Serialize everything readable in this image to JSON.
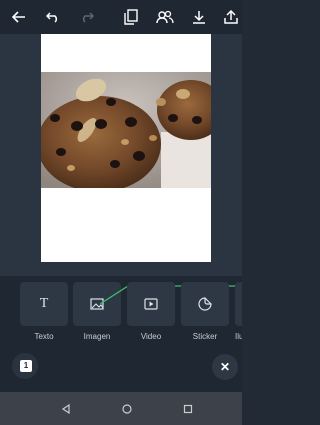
{
  "toolbar": {
    "icons": [
      "back-arrow-icon",
      "undo-icon",
      "redo-icon",
      "pages-icon",
      "collaborate-icon",
      "download-icon",
      "share-icon"
    ]
  },
  "canvas": {
    "image": "cookie-photo"
  },
  "elements_panel": {
    "items": [
      {
        "label": "Texto",
        "icon": "text-icon"
      },
      {
        "label": "Imagen",
        "icon": "image-icon"
      },
      {
        "label": "Video",
        "icon": "video-icon"
      },
      {
        "label": "Sticker",
        "icon": "sticker-icon"
      },
      {
        "label": "Ilu",
        "icon": "illustration-icon"
      }
    ],
    "text_glyph": "T",
    "accent_color": "#3fbf6a"
  },
  "page_badge": "1",
  "close_label": "✕",
  "navbar": {
    "icons": [
      "nav-back-icon",
      "nav-home-icon",
      "nav-recents-icon"
    ]
  }
}
